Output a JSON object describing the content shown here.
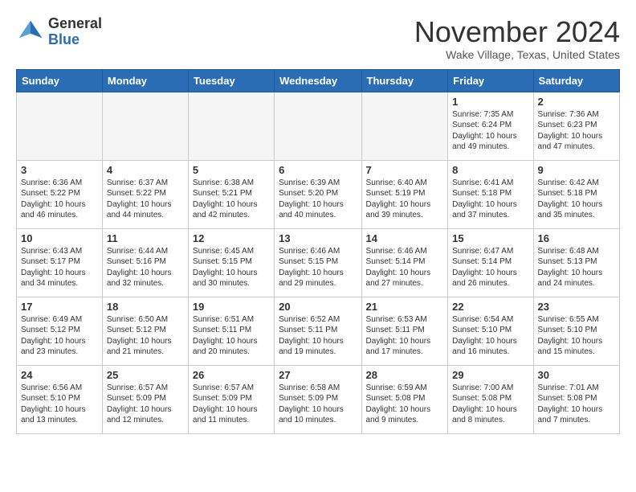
{
  "header": {
    "logo_general": "General",
    "logo_blue": "Blue",
    "month_title": "November 2024",
    "location": "Wake Village, Texas, United States"
  },
  "days_of_week": [
    "Sunday",
    "Monday",
    "Tuesday",
    "Wednesday",
    "Thursday",
    "Friday",
    "Saturday"
  ],
  "weeks": [
    [
      {
        "day": "",
        "info": "",
        "empty": true
      },
      {
        "day": "",
        "info": "",
        "empty": true
      },
      {
        "day": "",
        "info": "",
        "empty": true
      },
      {
        "day": "",
        "info": "",
        "empty": true
      },
      {
        "day": "",
        "info": "",
        "empty": true
      },
      {
        "day": "1",
        "info": "Sunrise: 7:35 AM\nSunset: 6:24 PM\nDaylight: 10 hours\nand 49 minutes."
      },
      {
        "day": "2",
        "info": "Sunrise: 7:36 AM\nSunset: 6:23 PM\nDaylight: 10 hours\nand 47 minutes."
      }
    ],
    [
      {
        "day": "3",
        "info": "Sunrise: 6:36 AM\nSunset: 5:22 PM\nDaylight: 10 hours\nand 46 minutes."
      },
      {
        "day": "4",
        "info": "Sunrise: 6:37 AM\nSunset: 5:22 PM\nDaylight: 10 hours\nand 44 minutes."
      },
      {
        "day": "5",
        "info": "Sunrise: 6:38 AM\nSunset: 5:21 PM\nDaylight: 10 hours\nand 42 minutes."
      },
      {
        "day": "6",
        "info": "Sunrise: 6:39 AM\nSunset: 5:20 PM\nDaylight: 10 hours\nand 40 minutes."
      },
      {
        "day": "7",
        "info": "Sunrise: 6:40 AM\nSunset: 5:19 PM\nDaylight: 10 hours\nand 39 minutes."
      },
      {
        "day": "8",
        "info": "Sunrise: 6:41 AM\nSunset: 5:18 PM\nDaylight: 10 hours\nand 37 minutes."
      },
      {
        "day": "9",
        "info": "Sunrise: 6:42 AM\nSunset: 5:18 PM\nDaylight: 10 hours\nand 35 minutes."
      }
    ],
    [
      {
        "day": "10",
        "info": "Sunrise: 6:43 AM\nSunset: 5:17 PM\nDaylight: 10 hours\nand 34 minutes."
      },
      {
        "day": "11",
        "info": "Sunrise: 6:44 AM\nSunset: 5:16 PM\nDaylight: 10 hours\nand 32 minutes."
      },
      {
        "day": "12",
        "info": "Sunrise: 6:45 AM\nSunset: 5:15 PM\nDaylight: 10 hours\nand 30 minutes."
      },
      {
        "day": "13",
        "info": "Sunrise: 6:46 AM\nSunset: 5:15 PM\nDaylight: 10 hours\nand 29 minutes."
      },
      {
        "day": "14",
        "info": "Sunrise: 6:46 AM\nSunset: 5:14 PM\nDaylight: 10 hours\nand 27 minutes."
      },
      {
        "day": "15",
        "info": "Sunrise: 6:47 AM\nSunset: 5:14 PM\nDaylight: 10 hours\nand 26 minutes."
      },
      {
        "day": "16",
        "info": "Sunrise: 6:48 AM\nSunset: 5:13 PM\nDaylight: 10 hours\nand 24 minutes."
      }
    ],
    [
      {
        "day": "17",
        "info": "Sunrise: 6:49 AM\nSunset: 5:12 PM\nDaylight: 10 hours\nand 23 minutes."
      },
      {
        "day": "18",
        "info": "Sunrise: 6:50 AM\nSunset: 5:12 PM\nDaylight: 10 hours\nand 21 minutes."
      },
      {
        "day": "19",
        "info": "Sunrise: 6:51 AM\nSunset: 5:11 PM\nDaylight: 10 hours\nand 20 minutes."
      },
      {
        "day": "20",
        "info": "Sunrise: 6:52 AM\nSunset: 5:11 PM\nDaylight: 10 hours\nand 19 minutes."
      },
      {
        "day": "21",
        "info": "Sunrise: 6:53 AM\nSunset: 5:11 PM\nDaylight: 10 hours\nand 17 minutes."
      },
      {
        "day": "22",
        "info": "Sunrise: 6:54 AM\nSunset: 5:10 PM\nDaylight: 10 hours\nand 16 minutes."
      },
      {
        "day": "23",
        "info": "Sunrise: 6:55 AM\nSunset: 5:10 PM\nDaylight: 10 hours\nand 15 minutes."
      }
    ],
    [
      {
        "day": "24",
        "info": "Sunrise: 6:56 AM\nSunset: 5:10 PM\nDaylight: 10 hours\nand 13 minutes."
      },
      {
        "day": "25",
        "info": "Sunrise: 6:57 AM\nSunset: 5:09 PM\nDaylight: 10 hours\nand 12 minutes."
      },
      {
        "day": "26",
        "info": "Sunrise: 6:57 AM\nSunset: 5:09 PM\nDaylight: 10 hours\nand 11 minutes."
      },
      {
        "day": "27",
        "info": "Sunrise: 6:58 AM\nSunset: 5:09 PM\nDaylight: 10 hours\nand 10 minutes."
      },
      {
        "day": "28",
        "info": "Sunrise: 6:59 AM\nSunset: 5:08 PM\nDaylight: 10 hours\nand 9 minutes."
      },
      {
        "day": "29",
        "info": "Sunrise: 7:00 AM\nSunset: 5:08 PM\nDaylight: 10 hours\nand 8 minutes."
      },
      {
        "day": "30",
        "info": "Sunrise: 7:01 AM\nSunset: 5:08 PM\nDaylight: 10 hours\nand 7 minutes."
      }
    ]
  ]
}
